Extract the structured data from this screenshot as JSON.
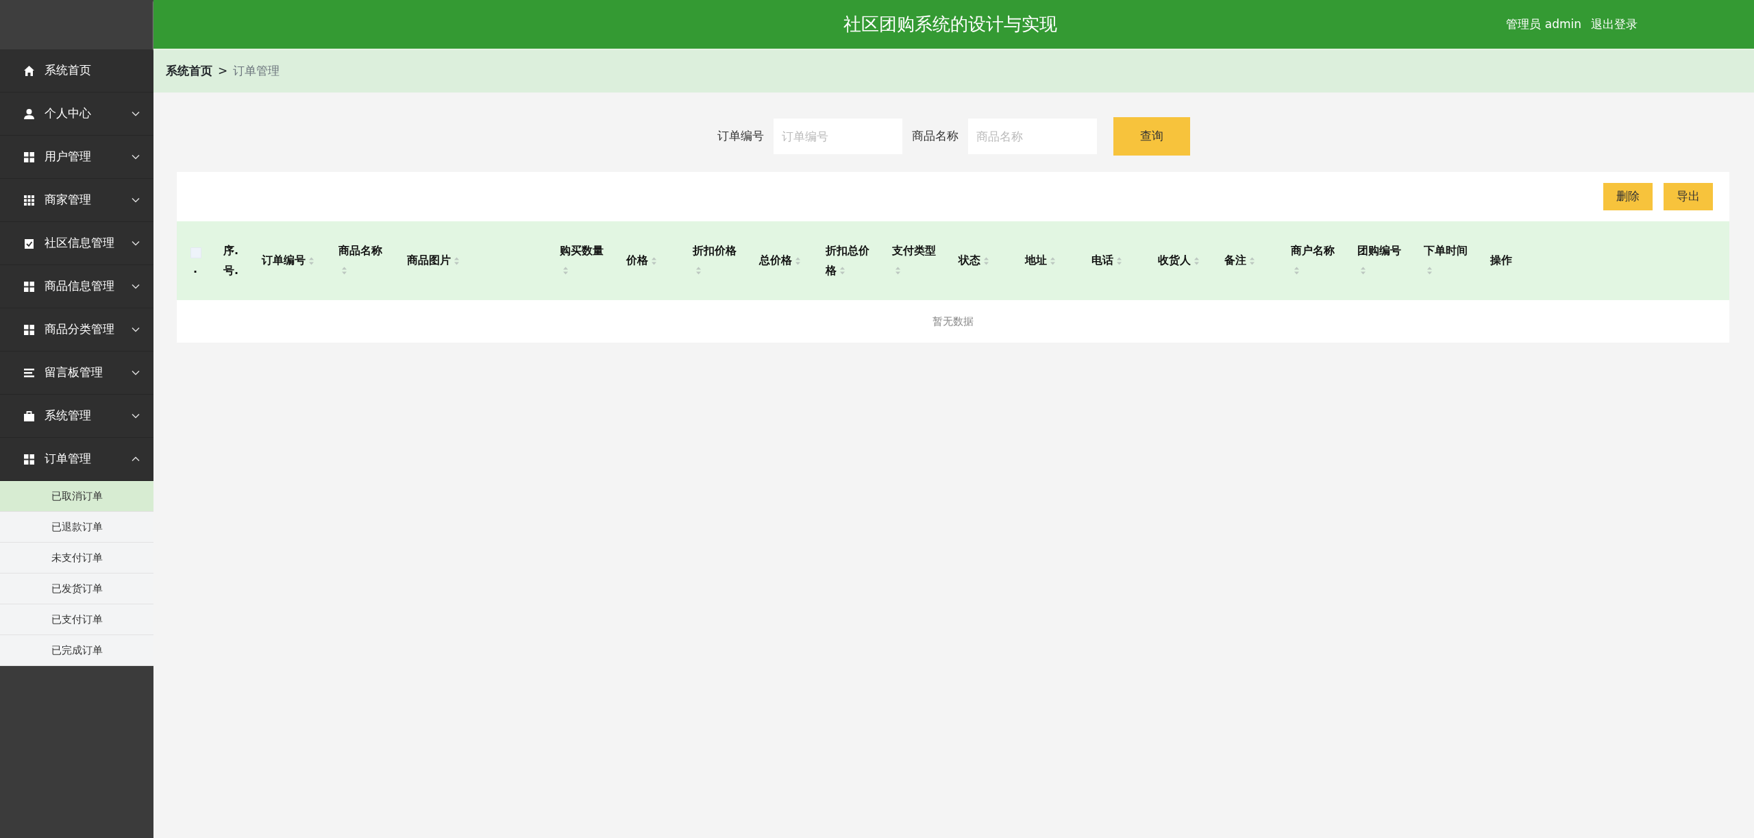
{
  "header": {
    "title": "社区团购系统的设计与实现",
    "user_label": "管理员 admin",
    "logout": "退出登录"
  },
  "sidebar": {
    "items": [
      {
        "label": "系统首页",
        "kind": "link"
      },
      {
        "label": "个人中心",
        "kind": "group",
        "expanded": false
      },
      {
        "label": "用户管理",
        "kind": "group",
        "expanded": false
      },
      {
        "label": "商家管理",
        "kind": "group",
        "expanded": false
      },
      {
        "label": "社区信息管理",
        "kind": "group",
        "expanded": false
      },
      {
        "label": "商品信息管理",
        "kind": "group",
        "expanded": false
      },
      {
        "label": "商品分类管理",
        "kind": "group",
        "expanded": false
      },
      {
        "label": "留言板管理",
        "kind": "group",
        "expanded": false
      },
      {
        "label": "系统管理",
        "kind": "group",
        "expanded": false
      },
      {
        "label": "订单管理",
        "kind": "group",
        "expanded": true,
        "children": [
          {
            "label": "已取消订单",
            "selected": true
          },
          {
            "label": "已退款订单",
            "selected": false
          },
          {
            "label": "未支付订单",
            "selected": false
          },
          {
            "label": "已发货订单",
            "selected": false
          },
          {
            "label": "已支付订单",
            "selected": false
          },
          {
            "label": "已完成订单",
            "selected": false
          }
        ]
      }
    ]
  },
  "breadcrumb": [
    {
      "label": "系统首页",
      "current": false
    },
    {
      "label": "订单管理",
      "current": true
    }
  ],
  "breadcrumb_separator": ">",
  "search": {
    "fields": [
      {
        "label": "订单编号",
        "placeholder": "订单编号"
      },
      {
        "label": "商品名称",
        "placeholder": "商品名称"
      }
    ],
    "button": "查询"
  },
  "table": {
    "actions": [
      "删除",
      "导出"
    ],
    "columns": [
      {
        "label": ".",
        "kind": "checkbox",
        "checked": false
      },
      {
        "label": "序.号.",
        "kind": "text",
        "sortable": false
      },
      {
        "label": "订单编号",
        "kind": "text",
        "sortable": true
      },
      {
        "label": "商品名称",
        "kind": "text",
        "sortable": true
      },
      {
        "label": "商品图片",
        "kind": "text",
        "sortable": true
      },
      {
        "label": "购买数量",
        "kind": "text",
        "sortable": true
      },
      {
        "label": "价格",
        "kind": "text",
        "sortable": true
      },
      {
        "label": "折扣价格",
        "kind": "text",
        "sortable": true
      },
      {
        "label": "总价格",
        "kind": "text",
        "sortable": true
      },
      {
        "label": "折扣总价格",
        "kind": "text",
        "sortable": true
      },
      {
        "label": "支付类型",
        "kind": "text",
        "sortable": true
      },
      {
        "label": "状态",
        "kind": "text",
        "sortable": true
      },
      {
        "label": "地址",
        "kind": "text",
        "sortable": true
      },
      {
        "label": "电话",
        "kind": "text",
        "sortable": true
      },
      {
        "label": "收货人",
        "kind": "text",
        "sortable": true
      },
      {
        "label": "备注",
        "kind": "text",
        "sortable": true
      },
      {
        "label": "商户名称",
        "kind": "text",
        "sortable": true
      },
      {
        "label": "团购编号",
        "kind": "text",
        "sortable": true
      },
      {
        "label": "下单时间",
        "kind": "text",
        "sortable": true
      },
      {
        "label": "操作",
        "kind": "text",
        "sortable": false
      }
    ],
    "empty_text": "暂无数据"
  }
}
